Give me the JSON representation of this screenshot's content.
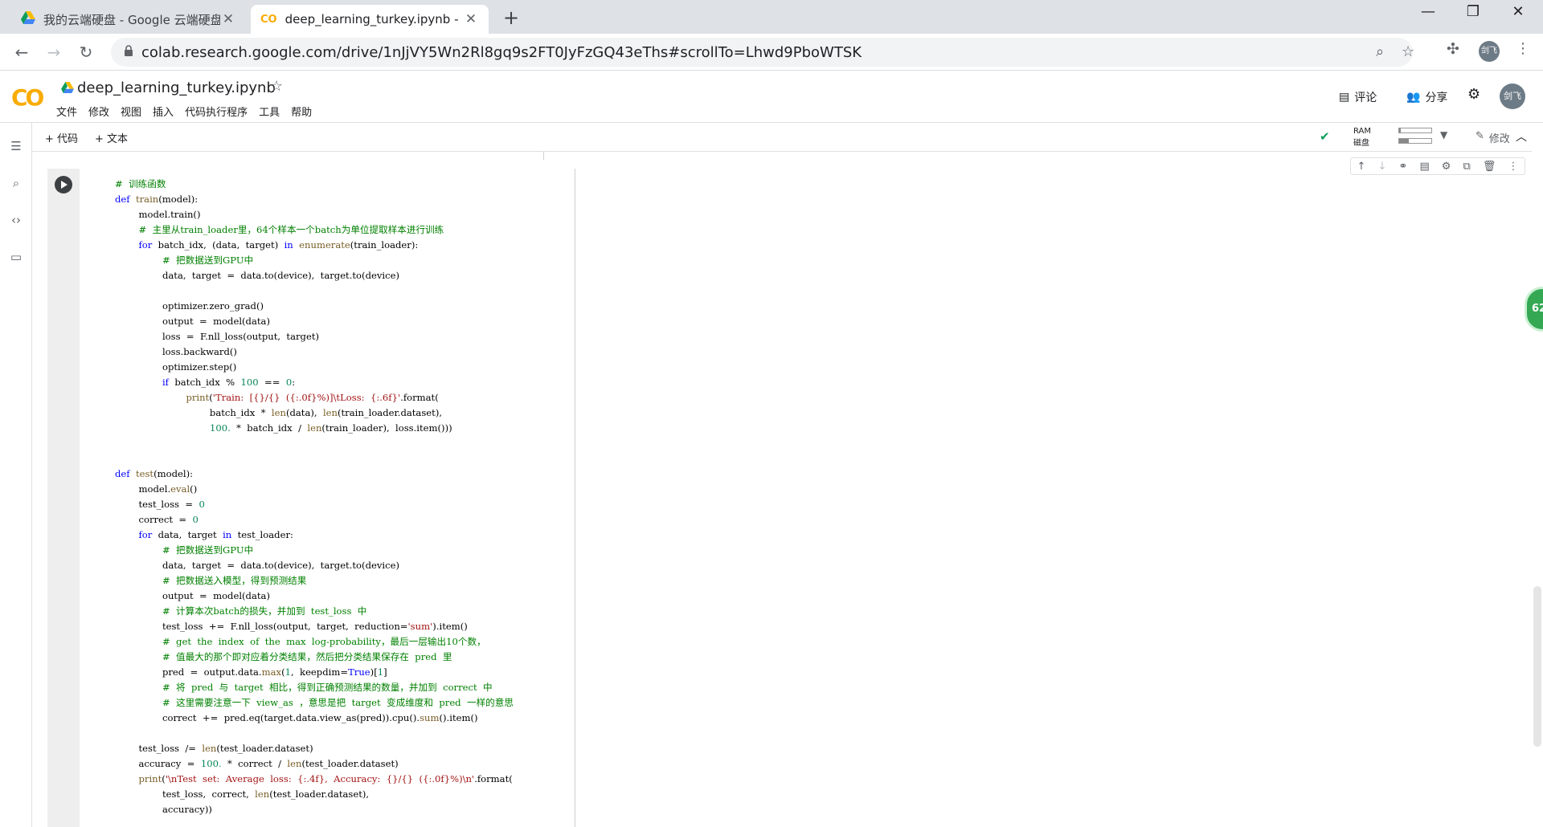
{
  "browser": {
    "tabs": [
      {
        "title": "我的云端硬盘 - Google 云端硬盘",
        "active": false,
        "icon": "google-drive-icon"
      },
      {
        "title": "deep_learning_turkey.ipynb - Colaboratory",
        "active": true,
        "icon": "colab-icon"
      }
    ],
    "url": "colab.research.google.com/drive/1nJjVY5Wn2Rl8gq9s2FT0JyFzGQ43eThs#scrollTo=Lhwd9PboWTSK",
    "profile_initials": "剑飞"
  },
  "colab": {
    "logo": "CO",
    "notebook_title": "deep_learning_turkey.ipynb",
    "menu": [
      "文件",
      "修改",
      "视图",
      "插入",
      "代码执行程序",
      "工具",
      "帮助"
    ],
    "comment_label": "评论",
    "share_label": "分享",
    "user_initials": "剑飞",
    "add_code_label": "+ 代码",
    "add_text_label": "+ 文本",
    "ram_label": "RAM",
    "disk_label": "磁盘",
    "ram_fraction": 0.05,
    "disk_fraction": 0.3,
    "edit_label": "修改",
    "side_badge": "62"
  },
  "colors": {
    "keyword": "#0000ff",
    "comment": "#008000",
    "string": "#a31515",
    "number": "#098658",
    "colab_orange": "#f9ab00"
  }
}
